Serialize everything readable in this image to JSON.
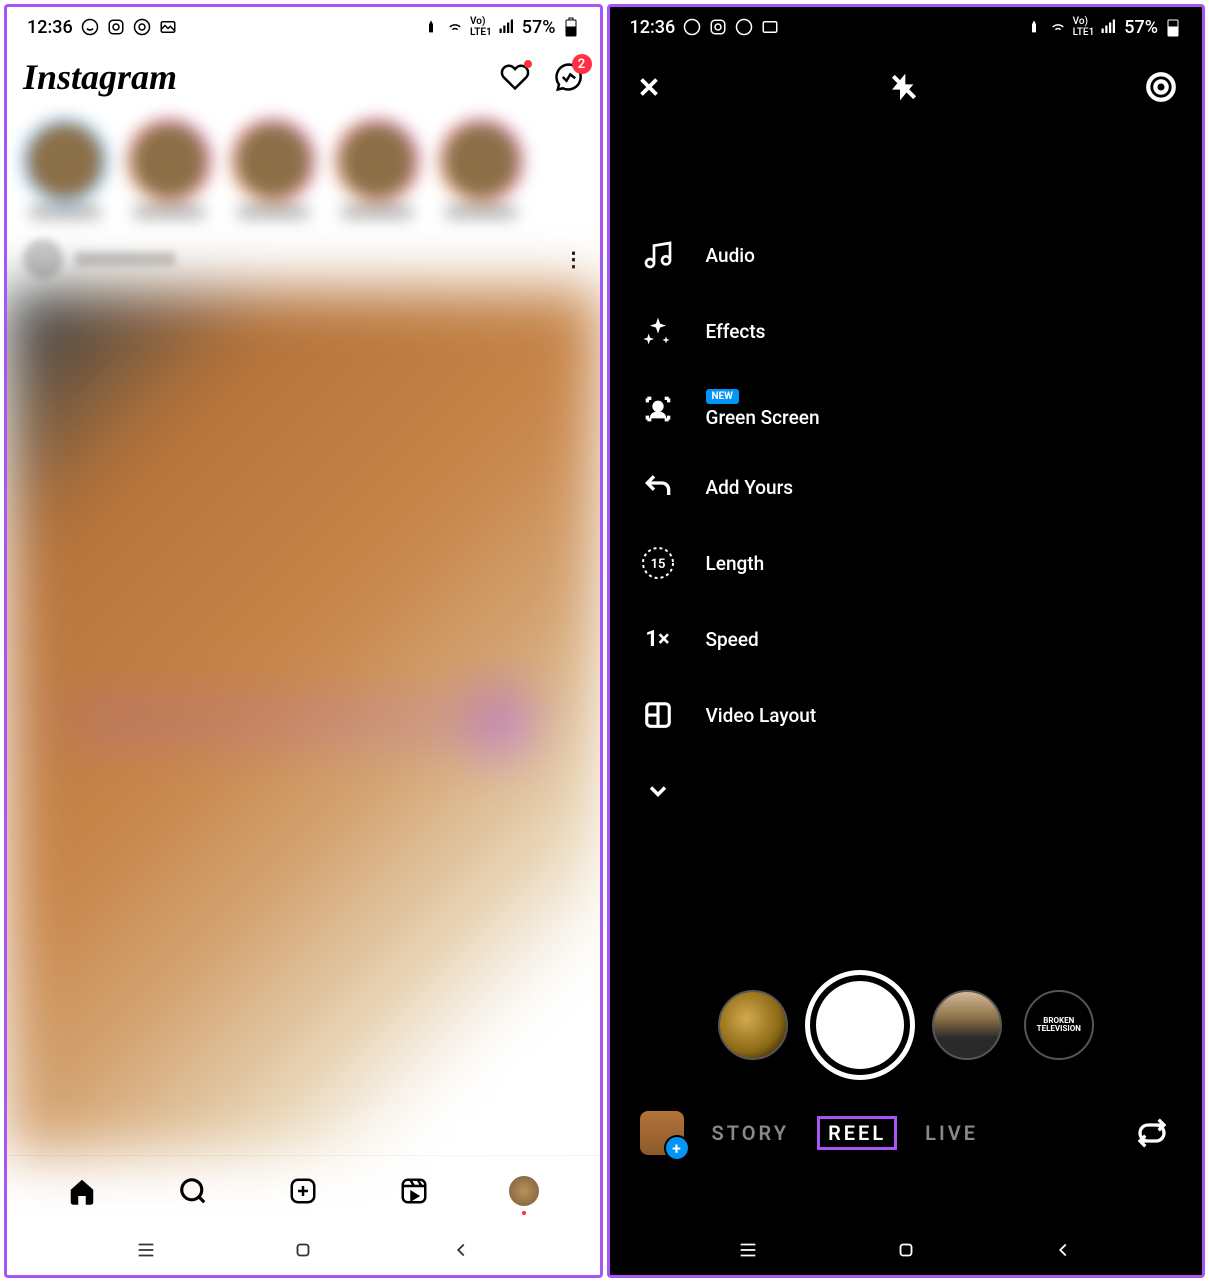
{
  "status": {
    "time": "12:36",
    "battery": "57%"
  },
  "left": {
    "logo": "Instagram",
    "msg_badge": "2",
    "nav": {}
  },
  "right": {
    "tools": {
      "audio": "Audio",
      "effects": "Effects",
      "green_new": "NEW",
      "green": "Green Screen",
      "addyours": "Add Yours",
      "length_val": "15",
      "length": "Length",
      "speed_val": "1×",
      "speed": "Speed",
      "layout": "Video Layout"
    },
    "filter_tv": "BROKEN TELEVISION",
    "modes": {
      "story": "STORY",
      "reel": "REEL",
      "live": "LIVE"
    }
  }
}
